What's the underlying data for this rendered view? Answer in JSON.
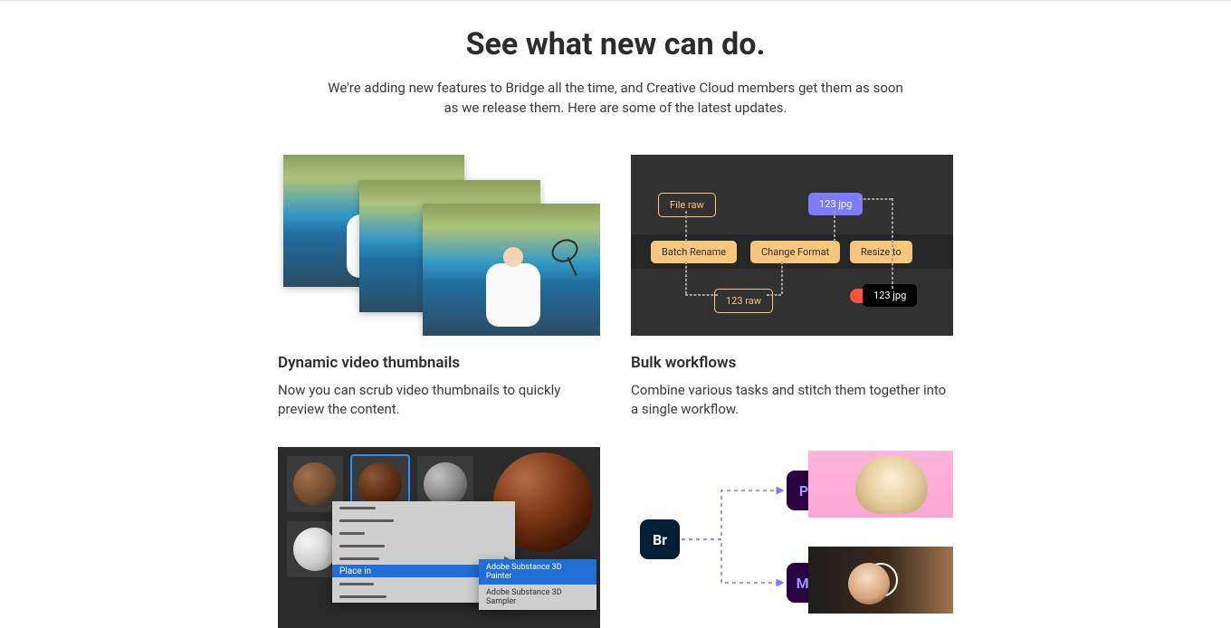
{
  "headline": "See what new can do.",
  "subhead": "We're adding new features to Bridge all the time, and Creative Cloud members get them as soon as we release them. Here are some of the latest updates.",
  "features": [
    {
      "title": "Dynamic video thumbnails",
      "body": "Now you can scrub video thumbnails to quickly preview the content."
    },
    {
      "title": "Bulk workflows",
      "body": "Combine various tasks and stitch them together into a single workflow."
    }
  ],
  "workflow": {
    "file_raw": "File raw",
    "jpg123": "123 jpg",
    "batch_rename": "Batch Rename",
    "change_format": "Change Format",
    "resize_to": "Resize to",
    "raw123": "123 raw",
    "jpg123_out": "123 jpg"
  },
  "context_menu": {
    "place_in": "Place in",
    "painter": "Adobe Substance 3D Painter",
    "sampler": "Adobe Substance 3D Sampler"
  },
  "app_chips": {
    "br": "Br",
    "pr": "Pr",
    "me": "Me"
  }
}
